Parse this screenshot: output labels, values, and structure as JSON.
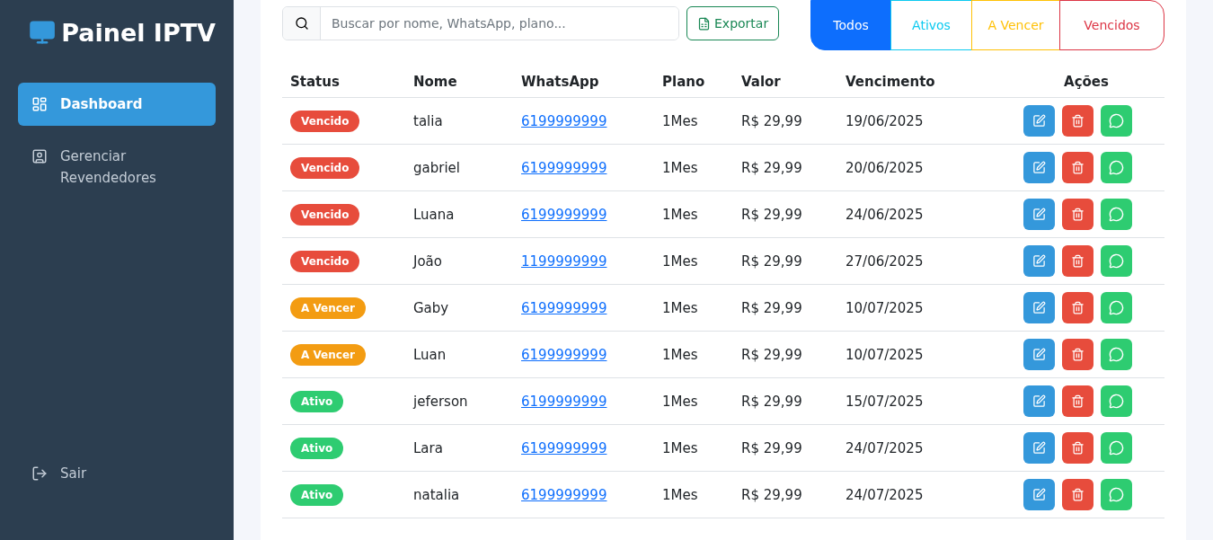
{
  "sidebar": {
    "logo": "Painel IPTV",
    "items": [
      {
        "label": "Dashboard",
        "kind": "dashboard",
        "selected": true
      },
      {
        "label": "Gerenciar Revendedores",
        "kind": "people",
        "selected": false
      }
    ],
    "logout": "Sair"
  },
  "toolbar": {
    "search": {
      "placeholder": "Buscar por nome, WhatsApp, plano..."
    },
    "export": "Exportar",
    "filters": [
      {
        "label": "Todos",
        "kind": "all",
        "selected": true
      },
      {
        "label": "Ativos",
        "kind": "active",
        "selected": false
      },
      {
        "label": "A Vencer",
        "kind": "due",
        "selected": false
      },
      {
        "label": "Vencidos",
        "kind": "expired",
        "selected": false
      }
    ]
  },
  "table": {
    "columns": [
      "Status",
      "Nome",
      "WhatsApp",
      "Plano",
      "Valor",
      "Vencimento",
      "Ações"
    ],
    "rows": [
      {
        "status": "Vencido",
        "kind": "expired",
        "name": "talia",
        "whatsapp": "6199999999",
        "plan": "1Mes",
        "value": "R$ 29,99",
        "due": "19/06/2025"
      },
      {
        "status": "Vencido",
        "kind": "expired",
        "name": "gabriel",
        "whatsapp": "6199999999",
        "plan": "1Mes",
        "value": "R$ 29,99",
        "due": "20/06/2025"
      },
      {
        "status": "Vencido",
        "kind": "expired",
        "name": "Luana",
        "whatsapp": "6199999999",
        "plan": "1Mes",
        "value": "R$ 29,99",
        "due": "24/06/2025"
      },
      {
        "status": "Vencido",
        "kind": "expired",
        "name": "João",
        "whatsapp": "1199999999",
        "plan": "1Mes",
        "value": "R$ 29,99",
        "due": "27/06/2025"
      },
      {
        "status": "A Vencer",
        "kind": "due",
        "name": "Gaby",
        "whatsapp": "6199999999",
        "plan": "1Mes",
        "value": "R$ 29,99",
        "due": "10/07/2025"
      },
      {
        "status": "A Vencer",
        "kind": "due",
        "name": "Luan",
        "whatsapp": "6199999999",
        "plan": "1Mes",
        "value": "R$ 29,99",
        "due": "10/07/2025"
      },
      {
        "status": "Ativo",
        "kind": "active",
        "name": "jeferson",
        "whatsapp": "6199999999",
        "plan": "1Mes",
        "value": "R$ 29,99",
        "due": "15/07/2025"
      },
      {
        "status": "Ativo",
        "kind": "active",
        "name": "Lara",
        "whatsapp": "6199999999",
        "plan": "1Mes",
        "value": "R$ 29,99",
        "due": "24/07/2025"
      },
      {
        "status": "Ativo",
        "kind": "active",
        "name": "natalia",
        "whatsapp": "6199999999",
        "plan": "1Mes",
        "value": "R$ 29,99",
        "due": "24/07/2025"
      }
    ]
  }
}
